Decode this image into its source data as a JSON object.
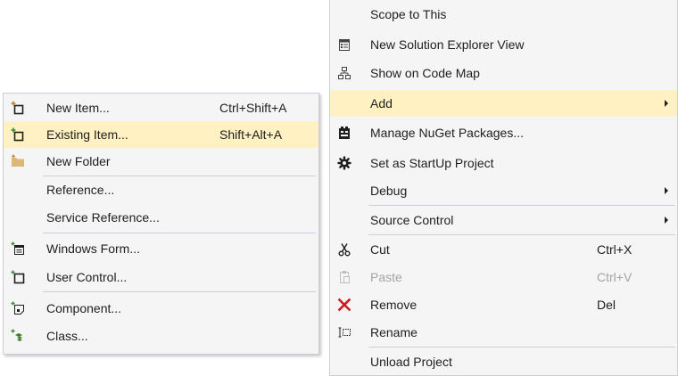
{
  "context_menu": {
    "items": [
      {
        "label": "Scope to This",
        "icon": "none"
      },
      {
        "label": "New Solution Explorer View",
        "icon": "new-explorer-view-icon"
      },
      {
        "label": "Show on Code Map",
        "icon": "code-map-icon"
      },
      {
        "label": "Add",
        "icon": "none",
        "submenu": true,
        "highlighted": true
      },
      {
        "label": "Manage NuGet Packages...",
        "icon": "nuget-icon"
      },
      {
        "label": "Set as StartUp Project",
        "icon": "gear-icon"
      },
      {
        "label": "Debug",
        "icon": "none",
        "submenu": true
      },
      {
        "label": "Source Control",
        "icon": "none",
        "submenu": true
      },
      {
        "label": "Cut",
        "shortcut": "Ctrl+X",
        "icon": "scissors-icon"
      },
      {
        "label": "Paste",
        "shortcut": "Ctrl+V",
        "icon": "paste-icon",
        "disabled": true
      },
      {
        "label": "Remove",
        "shortcut": "Del",
        "icon": "red-x-icon"
      },
      {
        "label": "Rename",
        "icon": "rename-icon"
      },
      {
        "label": "Unload Project",
        "icon": "none"
      }
    ]
  },
  "add_submenu": {
    "items": [
      {
        "label": "New Item...",
        "shortcut": "Ctrl+Shift+A",
        "icon": "new-item-icon"
      },
      {
        "label": "Existing Item...",
        "shortcut": "Shift+Alt+A",
        "icon": "existing-item-icon",
        "highlighted": true
      },
      {
        "label": "New Folder",
        "icon": "new-folder-icon"
      },
      {
        "label": "Reference...",
        "icon": "none"
      },
      {
        "label": "Service Reference...",
        "icon": "none"
      },
      {
        "label": "Windows Form...",
        "icon": "windows-form-icon"
      },
      {
        "label": "User Control...",
        "icon": "user-control-icon"
      },
      {
        "label": "Component...",
        "icon": "component-icon"
      },
      {
        "label": "Class...",
        "icon": "class-icon"
      }
    ]
  },
  "colors": {
    "menu_background": "#f5f5f5",
    "highlight": "#fff1c1",
    "separator": "#cccedb",
    "disabled_text": "#a2a4a5",
    "remove_icon": "#c71d23",
    "add_icon_green": "#388a34",
    "folder_icon": "#dcb67a"
  }
}
